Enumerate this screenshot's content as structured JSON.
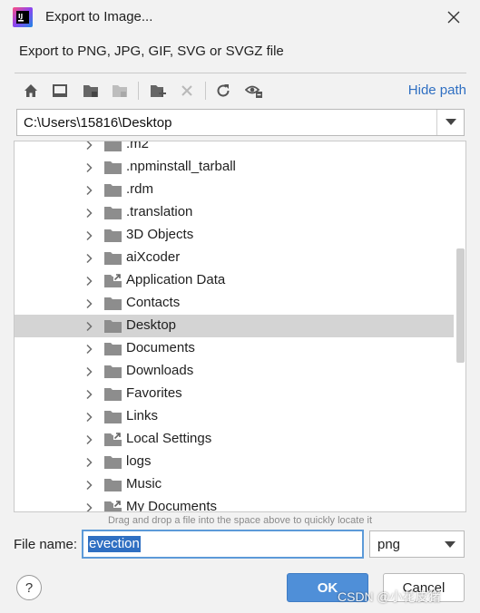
{
  "window": {
    "title": "Export to Image...",
    "subtitle": "Export to PNG, JPG, GIF, SVG or SVGZ file"
  },
  "toolbar": {
    "buttons": [
      "home-icon",
      "desktop-icon",
      "project-folder-icon",
      "module-folder-icon",
      "new-folder-icon",
      "delete-icon",
      "refresh-icon",
      "show-hidden-icon"
    ],
    "hide_path_label": "Hide path"
  },
  "path": {
    "value": "C:\\Users\\15816\\Desktop"
  },
  "tree": {
    "items": [
      {
        "label": ".m2",
        "type": "folder"
      },
      {
        "label": ".npminstall_tarball",
        "type": "folder"
      },
      {
        "label": ".rdm",
        "type": "folder"
      },
      {
        "label": ".translation",
        "type": "folder"
      },
      {
        "label": "3D Objects",
        "type": "folder"
      },
      {
        "label": "aiXcoder",
        "type": "folder"
      },
      {
        "label": "Application Data",
        "type": "link"
      },
      {
        "label": "Contacts",
        "type": "folder"
      },
      {
        "label": "Desktop",
        "type": "folder",
        "selected": true
      },
      {
        "label": "Documents",
        "type": "folder"
      },
      {
        "label": "Downloads",
        "type": "folder"
      },
      {
        "label": "Favorites",
        "type": "folder"
      },
      {
        "label": "Links",
        "type": "folder"
      },
      {
        "label": "Local Settings",
        "type": "link"
      },
      {
        "label": "logs",
        "type": "folder"
      },
      {
        "label": "Music",
        "type": "folder"
      },
      {
        "label": "My Documents",
        "type": "link"
      }
    ],
    "drag_hint": "Drag and drop a file into the space above to quickly locate it"
  },
  "file": {
    "name_label": "File name:",
    "name_value": "evection",
    "type_value": "png"
  },
  "buttons": {
    "help": "?",
    "ok": "OK",
    "cancel": "Cancel"
  },
  "watermark": "CSDN @小花皮猪",
  "colors": {
    "accent": "#2f6fc2",
    "ok_button": "#4f8fd8",
    "selection": "#d4d4d4"
  }
}
